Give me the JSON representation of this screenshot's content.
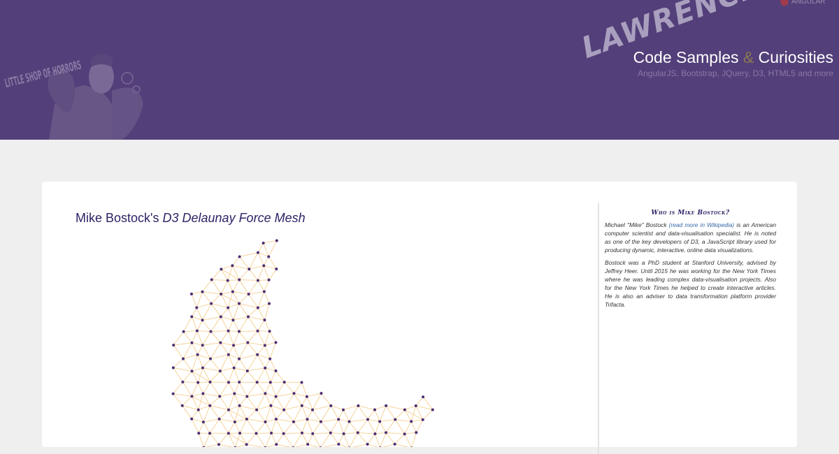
{
  "header": {
    "poster_text": "LITTLE SHOP OF HORRORS",
    "corner_logo_text": "ANGULAR",
    "brand_script": "LAWRENCE'S",
    "title_part1": "Code Samples",
    "title_amp": "&",
    "title_part2": "Curiosities",
    "subtitle": "AngularJS, Bootstrap, JQuery, D3, HTML5 and more"
  },
  "main": {
    "title_prefix": "Mike Bostock's",
    "title_emphasis": "D3 Delaunay Force Mesh"
  },
  "sidebar": {
    "heading": "Who is Mike Bostock?",
    "p1_before": "Michael \"Mike\" Bostock",
    "p1_link": "(read more in Wikipedia)",
    "p1_after": "is an American computer scientist and data-visualisation specialist. He is noted as one of the key developers of D3, a JavaScript library used for producing dynamic, interactive, online data visualizations.",
    "p2": "Bostock was a PhD student at Stanford University, advised by Jeffrey Heer. Until 2015 he was working for the New York Times where he was leading complex data-visualisation projects. Also for the New York Times he helped to create interactive articles. He is also an adviser to data transformation platform provider Trifacta."
  },
  "colors": {
    "header_bg": "#533f79",
    "node": "#4a2e77",
    "link": "#f7d39a",
    "title": "#2f2265",
    "link_text": "#3568a8"
  }
}
